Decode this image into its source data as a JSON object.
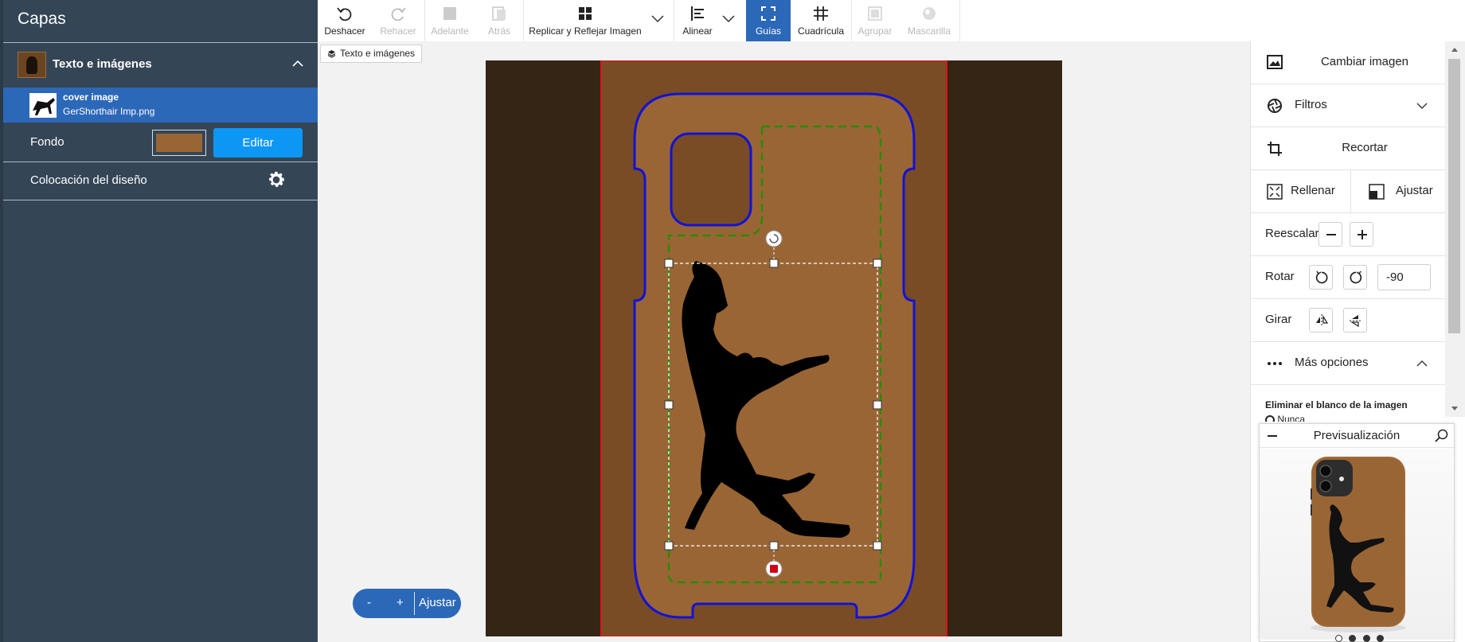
{
  "layers_panel": {
    "title": "Capas",
    "group_label": "Texto e imágenes",
    "item_name": "cover image",
    "item_file": "GerShorthair Imp.png",
    "fondo_label": "Fondo",
    "fondo_color": "#9a6535",
    "edit_label": "Editar",
    "placement_label": "Colocación del diseño"
  },
  "toolbar": {
    "buttons": [
      {
        "label": "Deshacer",
        "icon": "undo-icon",
        "enabled": true
      },
      {
        "label": "Rehacer",
        "icon": "redo-icon",
        "enabled": false
      },
      {
        "label": "Adelante",
        "icon": "bring-forward-icon",
        "enabled": false
      },
      {
        "label": "Atrás",
        "icon": "send-backward-icon",
        "enabled": false
      },
      {
        "label": "Replicar y Reflejar Imagen",
        "icon": "grid-icon",
        "enabled": true
      },
      {
        "label": "Alinear",
        "icon": "align-icon",
        "enabled": true
      },
      {
        "label": "Guías",
        "icon": "guides-icon",
        "enabled": true,
        "active": true
      },
      {
        "label": "Cuadrícula",
        "icon": "hash-grid-icon",
        "enabled": true
      },
      {
        "label": "Agrupar",
        "icon": "group-icon",
        "enabled": false
      },
      {
        "label": "Mascarilla",
        "icon": "mask-icon",
        "enabled": false
      }
    ]
  },
  "canvas": {
    "layer_tag": "Texto e imágenes",
    "zoom_minus": "-",
    "zoom_plus": "+",
    "zoom_fit": "Ajustar",
    "colors": {
      "bg_dark": "#352514",
      "case_fill": "#7a4c25",
      "inner_fill": "#9a6535",
      "outline": "#1212d6",
      "safe_zone": "#2a8a0a",
      "bleed": "#e0141a"
    }
  },
  "right_panel": {
    "change_image": "Cambiar imagen",
    "filters": "Filtros",
    "crop": "Recortar",
    "fill": "Rellenar",
    "fit": "Ajustar",
    "rescale": "Reescalar",
    "rotate": "Rotar",
    "rotate_value": "-90",
    "flip": "Girar",
    "more_options": "Más opciones",
    "remove_white": "Eliminar el blanco de la imagen",
    "remove_white_option": "Nunca"
  },
  "preview": {
    "title": "Previsualización",
    "dots": 4,
    "active_dot": 1
  }
}
